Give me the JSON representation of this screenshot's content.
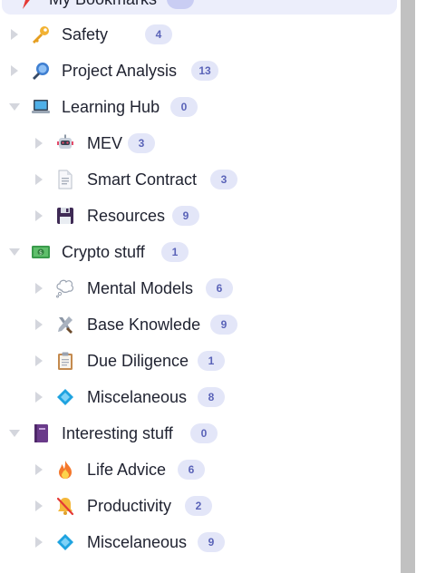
{
  "header": {
    "label": "My Bookmarks"
  },
  "items": [
    {
      "label": "Safety",
      "count": "4",
      "level": 0,
      "expanded": false,
      "icon": "key-icon"
    },
    {
      "label": "Project Analysis",
      "count": "13",
      "level": 0,
      "expanded": false,
      "icon": "magnifier-icon"
    },
    {
      "label": "Learning Hub",
      "count": "0",
      "level": 0,
      "expanded": true,
      "icon": "laptop-icon"
    },
    {
      "label": "MEV",
      "count": "3",
      "level": 1,
      "expanded": false,
      "icon": "robot-icon"
    },
    {
      "label": "Smart Contract",
      "count": "3",
      "level": 1,
      "expanded": false,
      "icon": "document-icon"
    },
    {
      "label": "Resources",
      "count": "9",
      "level": 1,
      "expanded": false,
      "icon": "floppy-disk-icon"
    },
    {
      "label": "Crypto stuff",
      "count": "1",
      "level": 0,
      "expanded": true,
      "icon": "dollar-bill-icon"
    },
    {
      "label": "Mental Models",
      "count": "6",
      "level": 1,
      "expanded": false,
      "icon": "thought-bubble-icon"
    },
    {
      "label": "Base Knowlede",
      "count": "9",
      "level": 1,
      "expanded": false,
      "icon": "hammer-wrench-icon"
    },
    {
      "label": "Due Diligence",
      "count": "1",
      "level": 1,
      "expanded": false,
      "icon": "clipboard-icon"
    },
    {
      "label": "Miscelaneous",
      "count": "8",
      "level": 1,
      "expanded": false,
      "icon": "blue-diamond-icon"
    },
    {
      "label": "Interesting stuff",
      "count": "0",
      "level": 0,
      "expanded": true,
      "icon": "purple-book-icon"
    },
    {
      "label": "Life Advice",
      "count": "6",
      "level": 1,
      "expanded": false,
      "icon": "fire-icon"
    },
    {
      "label": "Productivity",
      "count": "2",
      "level": 1,
      "expanded": false,
      "icon": "muted-bell-icon"
    },
    {
      "label": "Miscelaneous",
      "count": "9",
      "level": 1,
      "expanded": false,
      "icon": "blue-diamond-icon"
    }
  ]
}
